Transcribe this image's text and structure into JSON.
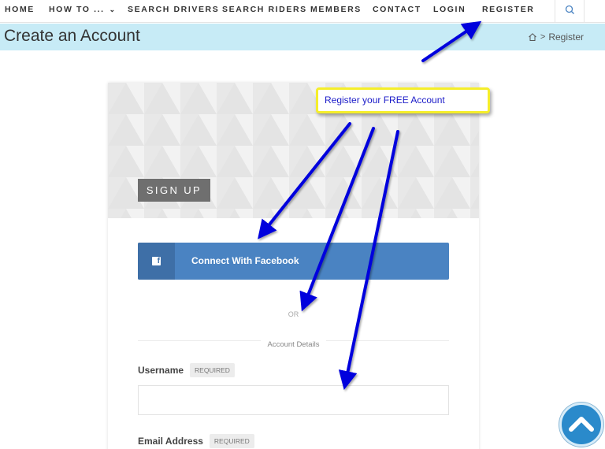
{
  "nav": {
    "items": [
      {
        "label": "HOME"
      },
      {
        "label": "HOW TO ...",
        "chevron": "⌄"
      },
      {
        "label": "SEARCH DRIVERS"
      },
      {
        "label": "SEARCH RIDERS"
      },
      {
        "label": "MEMBERS"
      },
      {
        "label": "CONTACT"
      },
      {
        "label": "LOGIN"
      },
      {
        "label": "REGISTER"
      }
    ],
    "search_icon": "search-icon"
  },
  "titlebar": {
    "title": "Create an Account",
    "breadcrumb_home_icon": "home-icon",
    "breadcrumb_separator": ">",
    "breadcrumb_current": "Register",
    "color": "#c7ebf6"
  },
  "form": {
    "badge": "SIGN UP",
    "facebook_button": "Connect With Facebook",
    "facebook_color": "#4a83c2",
    "or_text": "OR",
    "section_title": "Account Details",
    "fields": [
      {
        "label": "Username",
        "required": "REQUIRED",
        "value": "",
        "placeholder": ""
      },
      {
        "label": "Email Address",
        "required": "REQUIRED",
        "value": "",
        "placeholder": ""
      }
    ]
  },
  "annotation": {
    "callout_text": "Register your FREE Account",
    "arrow_color": "#0000dd",
    "callout_border": "#f5ee2a"
  },
  "scroll_top": {
    "icon": "chevron-up-icon"
  }
}
